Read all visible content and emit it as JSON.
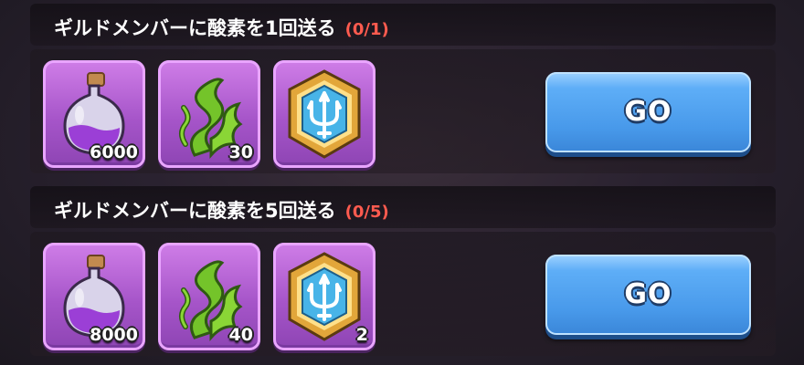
{
  "quests": [
    {
      "title": "ギルドメンバーに酸素を1回送る",
      "progress": "(0/1)",
      "rewards": [
        {
          "icon": "potion-bottle-icon",
          "count": "6000"
        },
        {
          "icon": "seaweed-icon",
          "count": "30"
        },
        {
          "icon": "trident-badge-icon",
          "count": ""
        }
      ],
      "button_label": "GO"
    },
    {
      "title": "ギルドメンバーに酸素を5回送る",
      "progress": "(0/5)",
      "rewards": [
        {
          "icon": "potion-bottle-icon",
          "count": "8000"
        },
        {
          "icon": "seaweed-icon",
          "count": "40"
        },
        {
          "icon": "trident-badge-icon",
          "count": "2"
        }
      ],
      "button_label": "GO"
    }
  ],
  "colors": {
    "progress_text": "#ff5b4f",
    "reward_tile": "#b060d4",
    "go_button": "#4a9bea"
  }
}
